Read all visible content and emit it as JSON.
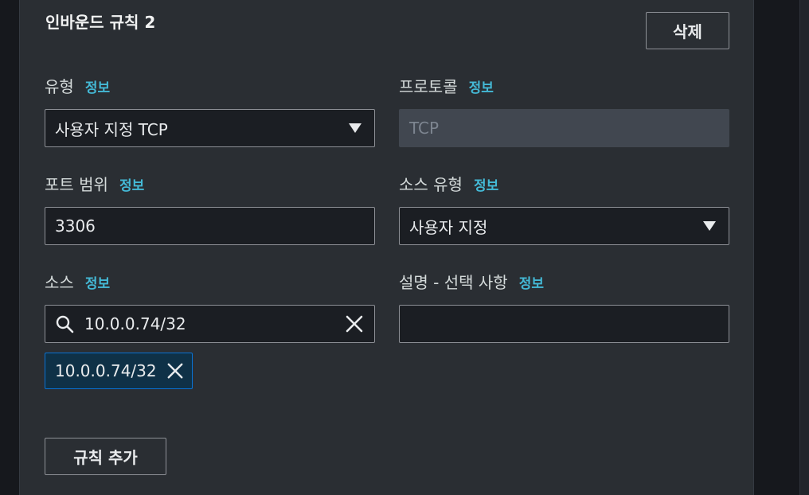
{
  "rule": {
    "title": "인바운드 규칙 2",
    "delete_label": "삭제",
    "info_label": "정보"
  },
  "type": {
    "label": "유형",
    "value": "사용자 지정 TCP"
  },
  "protocol": {
    "label": "프로토콜",
    "value": "TCP"
  },
  "port_range": {
    "label": "포트 범위",
    "value": "3306"
  },
  "source_type": {
    "label": "소스 유형",
    "value": "사용자 지정"
  },
  "source": {
    "label": "소스",
    "search_value": "10.0.0.74/32",
    "tokens": [
      "10.0.0.74/32"
    ]
  },
  "description": {
    "label": "설명 - 선택 사항",
    "value": ""
  },
  "add_rule_label": "규칙 추가",
  "colors": {
    "panel_bg": "#2a2e33",
    "input_bg": "#1b1e23",
    "info_link": "#44b9d6",
    "token_border": "#0972d3",
    "token_bg": "#0f3147"
  },
  "icons": {
    "type_dropdown": "caret-down-icon",
    "source_type_dropdown": "caret-down-icon",
    "source_search": "search-icon",
    "source_clear": "close-icon",
    "token_dismiss": "close-icon"
  }
}
